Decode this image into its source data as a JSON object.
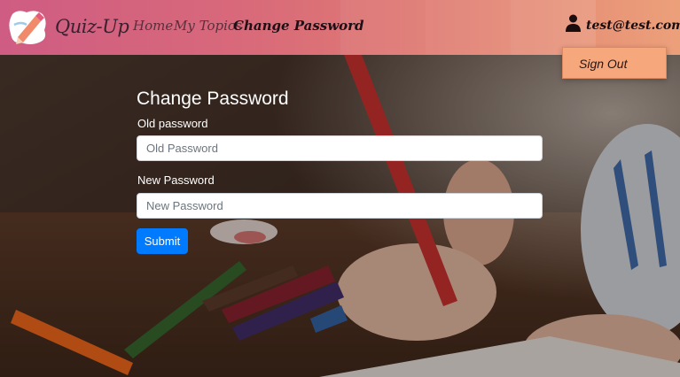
{
  "brand": {
    "name": "Quiz-Up"
  },
  "nav": {
    "links": [
      {
        "label": "Home"
      },
      {
        "label": "My Topics"
      },
      {
        "label": "Change Password",
        "active": true
      }
    ]
  },
  "user": {
    "email": "test@test.com",
    "icon": "user-icon"
  },
  "dropdown": {
    "items": [
      {
        "label": "Sign Out"
      }
    ]
  },
  "form": {
    "title": "Change Password",
    "old_password": {
      "label": "Old password",
      "placeholder": "Old Password",
      "value": ""
    },
    "new_password": {
      "label": "New Password",
      "placeholder": "New Password",
      "value": ""
    },
    "submit_label": "Submit"
  },
  "colors": {
    "navbar_start": "#cf5c83",
    "navbar_end": "#eca07a",
    "dropdown_bg": "#f6a77b",
    "submit_bg": "#007bff"
  }
}
